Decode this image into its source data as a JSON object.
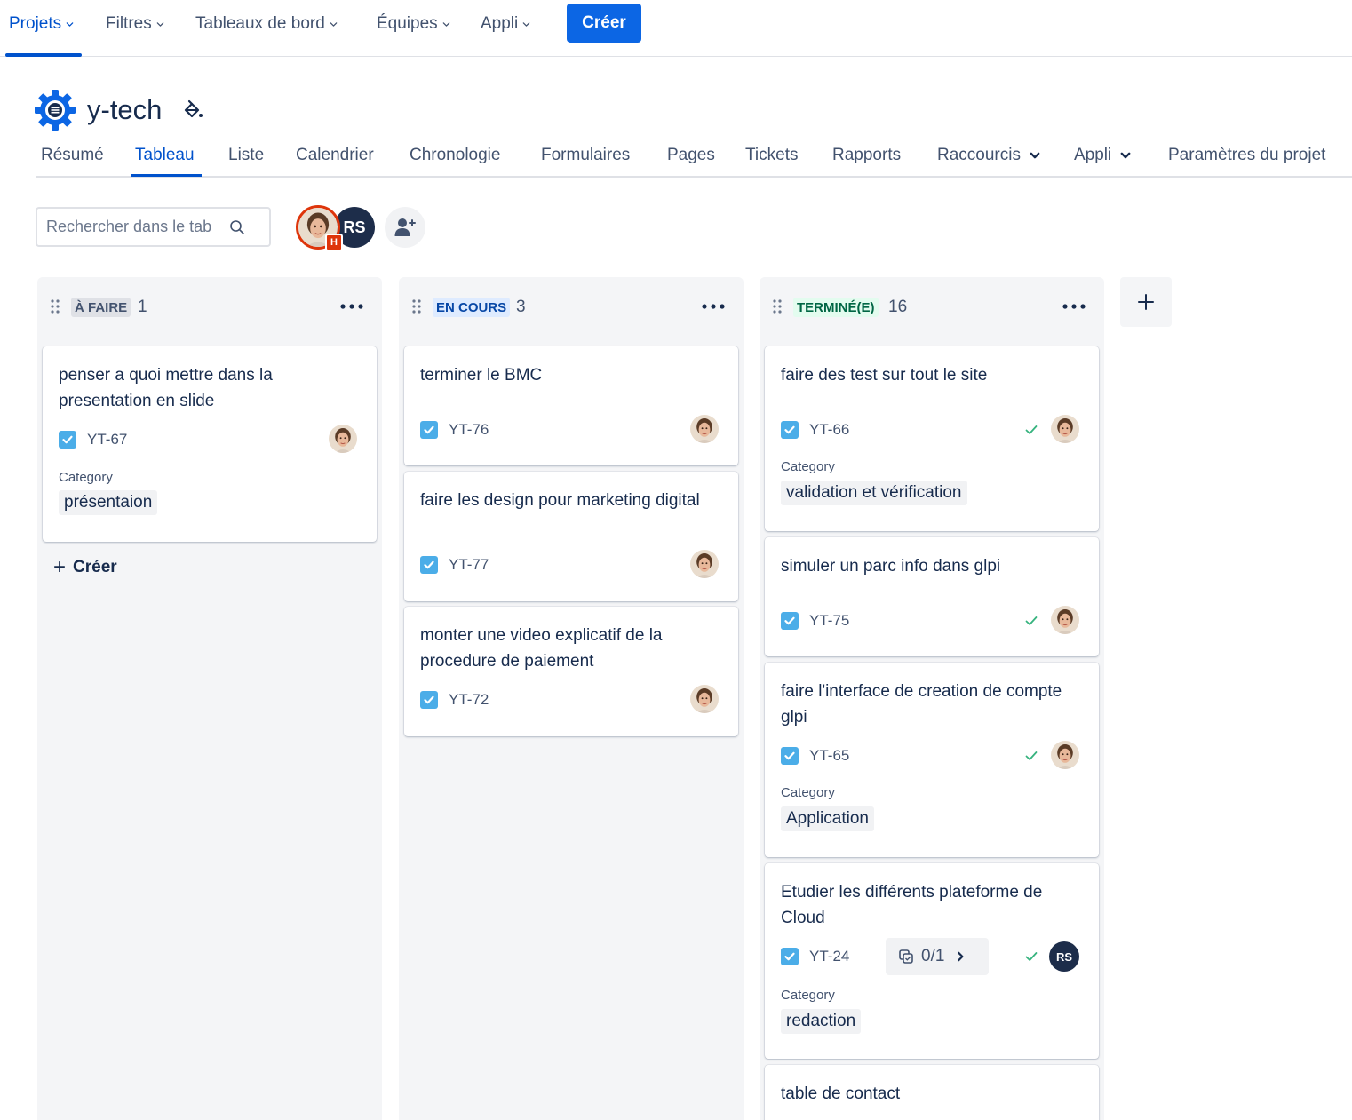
{
  "topnav": {
    "items": [
      "Projets",
      "Filtres",
      "Tableaux de bord",
      "Équipes",
      "Appli"
    ],
    "create_label": "Créer"
  },
  "project": {
    "name": "y-tech",
    "tabs": [
      "Résumé",
      "Tableau",
      "Liste",
      "Calendrier",
      "Chronologie",
      "Formulaires",
      "Pages",
      "Tickets",
      "Rapports",
      "Raccourcis",
      "Appli",
      "Paramètres du projet"
    ],
    "active_tab": "Tableau"
  },
  "toolbar": {
    "search_placeholder": "Rechercher dans le tab",
    "avatar_initials": "RS",
    "avatar_badge": "H"
  },
  "colors": {
    "accent": "#0052cc",
    "button": "#0c66e4",
    "todo_lozenge_bg": "#dfe1e6",
    "inprogress_lozenge_bg": "#deebff",
    "inprogress_lozenge_fg": "#0747a6",
    "done_lozenge_bg": "#e3fcef",
    "done_lozenge_fg": "#006644",
    "checkbox": "#4bade8",
    "done_check": "#36b37e"
  },
  "columns": [
    {
      "status": "À FAIRE",
      "count": "1",
      "create_label": "Créer",
      "cards": [
        {
          "title": "penser a quoi mettre dans la presentation en slide",
          "key": "YT-67",
          "category_label": "Category",
          "category": "présentaion"
        }
      ]
    },
    {
      "status": "EN COURS",
      "count": "3",
      "cards": [
        {
          "title": "terminer le BMC",
          "key": "YT-76"
        },
        {
          "title": "faire les design pour marketing digital",
          "key": "YT-77"
        },
        {
          "title": "monter une video explicatif de la procedure de paiement",
          "key": "YT-72"
        }
      ]
    },
    {
      "status": "TERMINÉ(E)",
      "count": "16",
      "cards": [
        {
          "title": "faire des test sur tout le site",
          "key": "YT-66",
          "category_label": "Category",
          "category": "validation et vérification"
        },
        {
          "title": "simuler un parc info dans glpi",
          "key": "YT-75"
        },
        {
          "title": "faire l'interface de creation de compte glpi",
          "key": "YT-65",
          "category_label": "Category",
          "category": "Application"
        },
        {
          "title": "Etudier les différents plateforme de Cloud",
          "key": "YT-24",
          "subtasks": "0/1",
          "assignee": "RS",
          "category_label": "Category",
          "category": "redaction"
        },
        {
          "title": "table de contact"
        }
      ]
    }
  ]
}
